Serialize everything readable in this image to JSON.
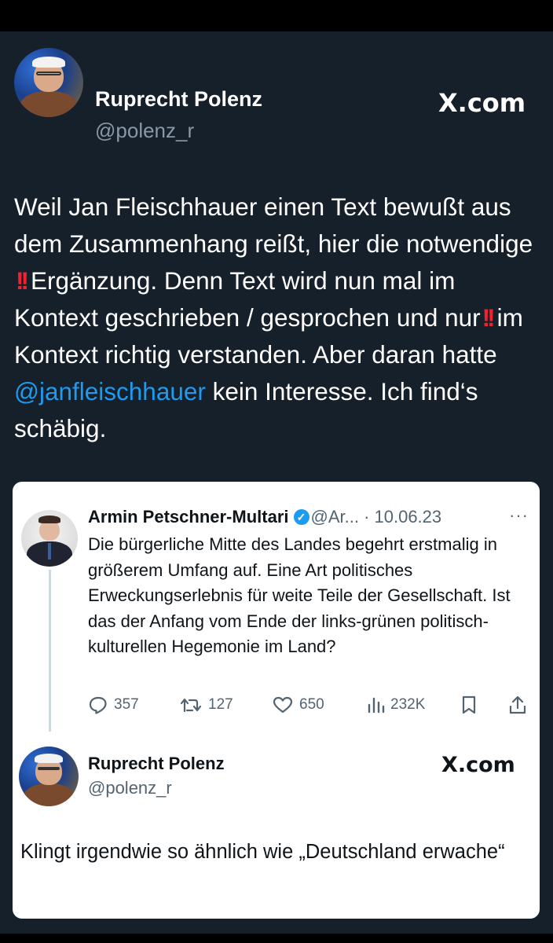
{
  "tweet": {
    "author_name": "Ruprecht Polenz",
    "author_handle": "@polenz_r",
    "brand": "X.com",
    "text_part1": "Weil Jan Fleischhauer einen Text bewußt aus dem Zusammenhang reißt, hier die notwendige ",
    "bang1": "!!",
    "text_part2": "Ergänzung. Denn Text wird nun mal im Kontext geschrieben / gesprochen und nur",
    "bang2": "!!",
    "text_part3": "im Kontext richtig verstanden. Aber daran hatte ",
    "mention": "@janfleischhauer",
    "text_part4": " kein Interesse. Ich find‘s schäbig."
  },
  "quoted": {
    "author_name": "Armin Petschner-Multari",
    "verified_icon": "verified-badge-icon",
    "meta": "@Ar... · 10.06.23",
    "more": "···",
    "text": "Die bürgerliche Mitte des Landes begehrt erstmalig in größerem Umfang auf. Eine Art politisches Erweckungserlebnis für weite Teile der Gesellschaft. Ist das der Anfang vom Ende der links-grünen politisch-kulturellen Hegemonie im Land?",
    "replies": "357",
    "retweets": "127",
    "likes": "650",
    "views": "232K"
  },
  "reply": {
    "author_name": "Ruprecht Polenz",
    "author_handle": "@polenz_r",
    "brand": "X.com",
    "text": "Klingt irgendwie so ähnlich wie „Deutschland erwache“"
  },
  "colors": {
    "dark_bg": "#15202b",
    "mention": "#1d9bf0",
    "alert_red": "#f4212e",
    "card_bg": "#ffffff"
  }
}
